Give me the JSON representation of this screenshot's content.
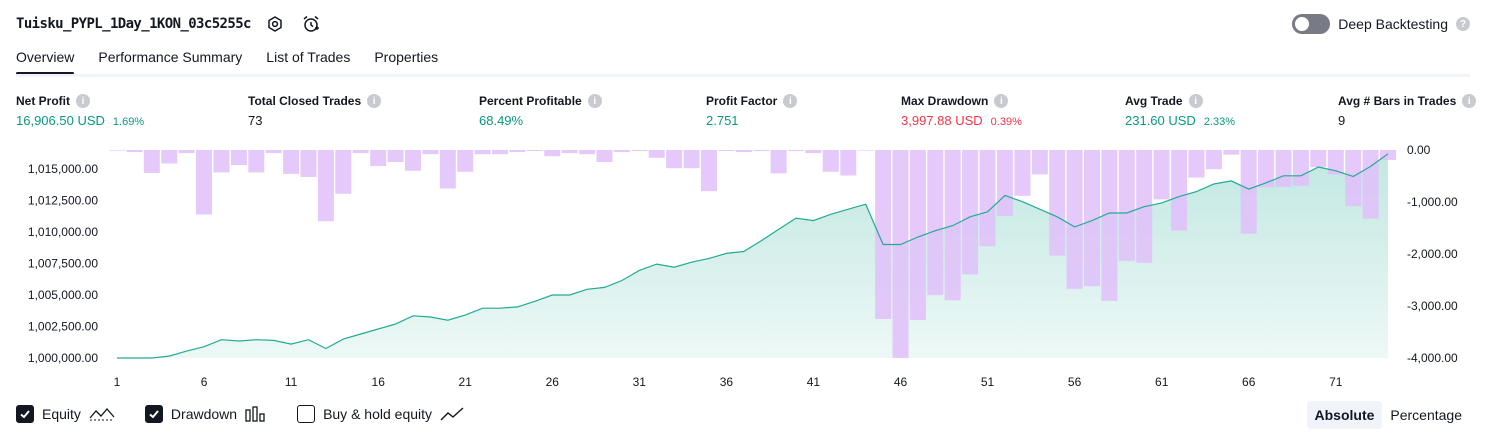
{
  "header": {
    "strategy_title": "Tuisku_PYPL_1Day_1KON_03c5255c",
    "deep_backtesting_label": "Deep Backtesting",
    "deep_backtesting_enabled": false
  },
  "tabs": [
    {
      "label": "Overview",
      "active": true
    },
    {
      "label": "Performance Summary",
      "active": false
    },
    {
      "label": "List of Trades",
      "active": false
    },
    {
      "label": "Properties",
      "active": false
    }
  ],
  "metrics": [
    {
      "label": "Net Profit",
      "value": "16,906.50 USD",
      "sub": "1.69%",
      "color": "#089981"
    },
    {
      "label": "Total Closed Trades",
      "value": "73",
      "sub": "",
      "color": "#131722"
    },
    {
      "label": "Percent Profitable",
      "value": "68.49%",
      "sub": "",
      "color": "#089981"
    },
    {
      "label": "Profit Factor",
      "value": "2.751",
      "sub": "",
      "color": "#089981"
    },
    {
      "label": "Max Drawdown",
      "value": "3,997.88 USD",
      "sub": "0.39%",
      "color": "#f23645"
    },
    {
      "label": "Avg Trade",
      "value": "231.60 USD",
      "sub": "2.33%",
      "color": "#089981"
    },
    {
      "label": "Avg # Bars in Trades",
      "value": "9",
      "sub": "",
      "color": "#131722"
    }
  ],
  "legend": {
    "equity_label": "Equity",
    "equity_checked": true,
    "drawdown_label": "Drawdown",
    "drawdown_checked": true,
    "buyhold_label": "Buy & hold equity",
    "buyhold_checked": false
  },
  "view_mode": {
    "absolute_label": "Absolute",
    "percentage_label": "Percentage",
    "selected": "Absolute"
  },
  "colors": {
    "equity_line": "#22ab94",
    "equity_fill": "#22ab94",
    "drawdown_fill": "#e1bffa",
    "positive": "#089981",
    "negative": "#f23645"
  },
  "chart_data": {
    "type": "area",
    "x_ticks": [
      "1",
      "6",
      "11",
      "16",
      "21",
      "26",
      "31",
      "36",
      "41",
      "46",
      "51",
      "56",
      "61",
      "66",
      "71"
    ],
    "y_left_ticks": [
      "1,000,000.00",
      "1,002,500.00",
      "1,005,000.00",
      "1,007,500.00",
      "1,010,000.00",
      "1,012,500.00",
      "1,015,000.00"
    ],
    "y_right_ticks": [
      "0.00",
      "-1,000.00",
      "-2,000.00",
      "-3,000.00",
      "-4,000.00"
    ],
    "ylim_equity": [
      1000000,
      1016500
    ],
    "ylim_drawdown": [
      -4000,
      0
    ],
    "x_range": [
      1,
      74
    ],
    "series": [
      {
        "name": "Equity",
        "x": [
          1,
          2,
          3,
          4,
          5,
          6,
          7,
          8,
          9,
          10,
          11,
          12,
          13,
          14,
          15,
          16,
          17,
          18,
          19,
          20,
          21,
          22,
          23,
          24,
          25,
          26,
          27,
          28,
          29,
          30,
          31,
          32,
          33,
          34,
          35,
          36,
          37,
          38,
          39,
          40,
          41,
          42,
          43,
          44,
          45,
          46,
          47,
          48,
          49,
          50,
          51,
          52,
          53,
          54,
          55,
          56,
          57,
          58,
          59,
          60,
          61,
          62,
          63,
          64,
          65,
          66,
          67,
          68,
          69,
          70,
          71,
          72,
          73,
          74
        ],
        "values": [
          1000000,
          1000000,
          1000000,
          1000150,
          1000550,
          1000900,
          1001450,
          1001350,
          1001450,
          1001400,
          1001100,
          1001450,
          1000750,
          1001500,
          1001900,
          1002300,
          1002700,
          1003350,
          1003250,
          1003000,
          1003400,
          1003950,
          1003950,
          1004050,
          1004500,
          1005000,
          1005000,
          1005450,
          1005600,
          1006150,
          1006950,
          1007450,
          1007200,
          1007600,
          1007900,
          1008300,
          1008450,
          1009300,
          1010200,
          1011100,
          1010900,
          1011400,
          1011800,
          1012200,
          1009000,
          1009000,
          1009600,
          1010100,
          1010500,
          1011200,
          1011600,
          1012900,
          1012400,
          1011800,
          1011200,
          1010400,
          1010900,
          1011500,
          1011500,
          1012000,
          1012300,
          1012800,
          1013200,
          1013800,
          1014050,
          1013400,
          1013900,
          1014450,
          1014450,
          1015150,
          1014850,
          1014400,
          1015200,
          1016200
        ]
      },
      {
        "name": "Drawdown",
        "x": [
          1,
          2,
          3,
          4,
          5,
          6,
          7,
          8,
          9,
          10,
          11,
          12,
          13,
          14,
          15,
          16,
          17,
          18,
          19,
          20,
          21,
          22,
          23,
          24,
          25,
          26,
          27,
          28,
          29,
          30,
          31,
          32,
          33,
          34,
          35,
          36,
          37,
          38,
          39,
          40,
          41,
          42,
          43,
          44,
          45,
          46,
          47,
          48,
          49,
          50,
          51,
          52,
          53,
          54,
          55,
          56,
          57,
          58,
          59,
          60,
          61,
          62,
          63,
          64,
          65,
          66,
          67,
          68,
          69,
          70,
          71,
          72,
          73,
          74
        ],
        "values": [
          0,
          -40,
          -440,
          -260,
          -60,
          -1240,
          -430,
          -290,
          -430,
          -60,
          -460,
          -520,
          -1370,
          -840,
          -60,
          -310,
          -230,
          -400,
          -80,
          -740,
          -420,
          -80,
          -80,
          -40,
          -20,
          -120,
          -60,
          -80,
          -230,
          -40,
          -20,
          -150,
          -350,
          -350,
          -790,
          -20,
          -40,
          -20,
          -450,
          -20,
          -60,
          -420,
          -490,
          0,
          -3250,
          -4000,
          -3270,
          -2790,
          -2890,
          -2390,
          -1850,
          -1270,
          -880,
          -470,
          -2030,
          -2670,
          -2620,
          -2900,
          -2130,
          -2170,
          -950,
          -1550,
          -530,
          -370,
          -90,
          -1610,
          -720,
          -710,
          -690,
          -330,
          -470,
          -1080,
          -1320,
          -190
        ]
      }
    ],
    "title": "",
    "xlabel": "",
    "ylabel": "",
    "grid": false,
    "legend_position": "bottom-left"
  }
}
